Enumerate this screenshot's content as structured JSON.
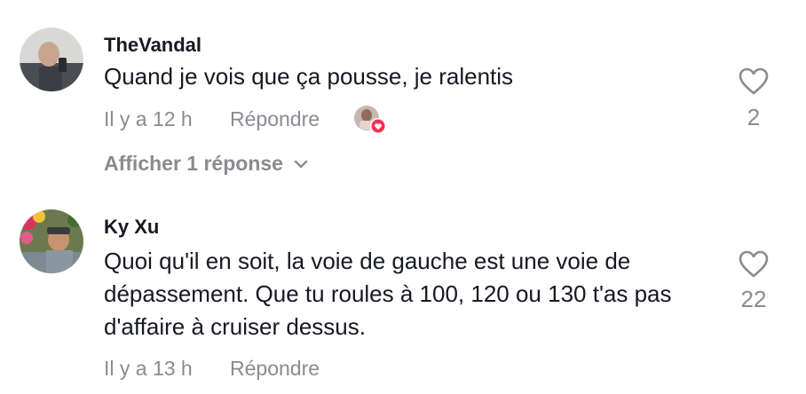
{
  "comments": [
    {
      "username": "TheVandal",
      "text": "Quand je vois que ça pousse, je ralentis",
      "time": "Il y a 12 h",
      "reply_label": "Répondre",
      "likes": "2",
      "view_replies": "Afficher 1 réponse",
      "creator_liked": true
    },
    {
      "username": "Ky Xu",
      "text": "Quoi qu'il en soit, la voie de gauche est une voie de dépassement. Que tu roules à 100, 120 ou 130 t'as pas d'affaire à cruiser dessus.",
      "time": "Il y a 13 h",
      "reply_label": "Répondre",
      "likes": "22"
    }
  ],
  "colors": {
    "text": "#161823",
    "secondary": "#8a8b91",
    "heart_badge": "#fe2c55"
  },
  "icons": {
    "like": "heart-outline-icon",
    "expand": "chevron-down-icon",
    "creator_like": "heart-badge-icon"
  }
}
